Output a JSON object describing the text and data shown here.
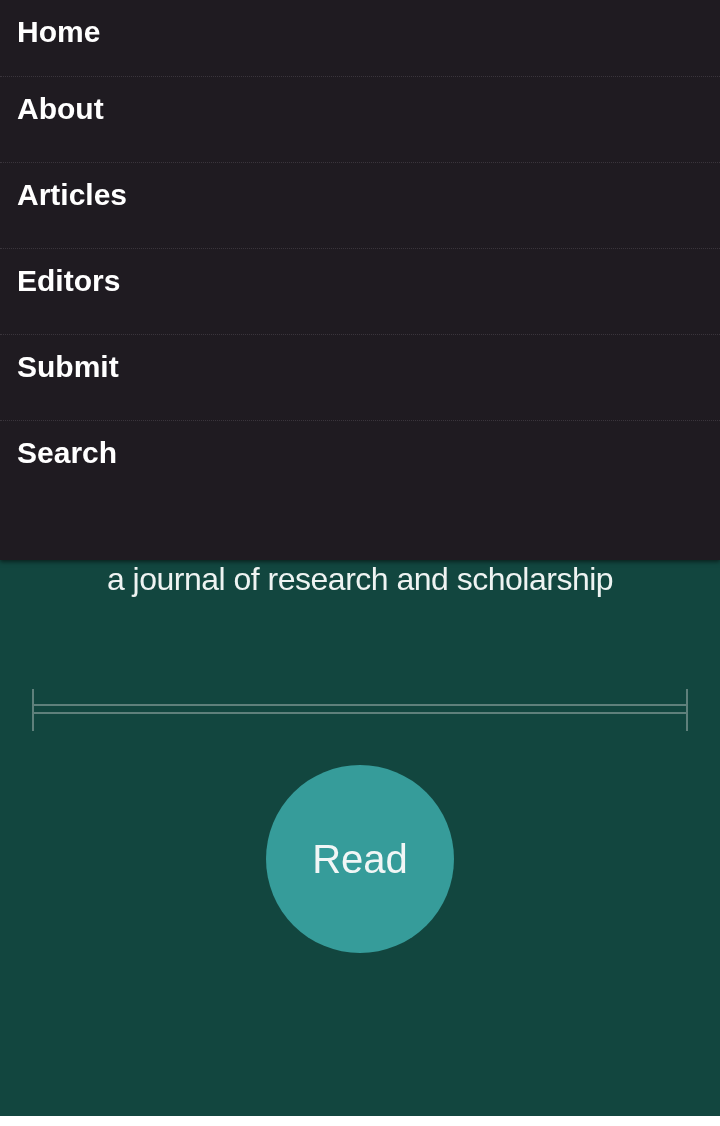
{
  "menu": {
    "items": [
      {
        "label": "Home"
      },
      {
        "label": "About"
      },
      {
        "label": "Articles"
      },
      {
        "label": "Editors"
      },
      {
        "label": "Submit"
      },
      {
        "label": "Search"
      }
    ]
  },
  "hero": {
    "tagline": "a journal of research and scholarship",
    "button": "Read"
  }
}
